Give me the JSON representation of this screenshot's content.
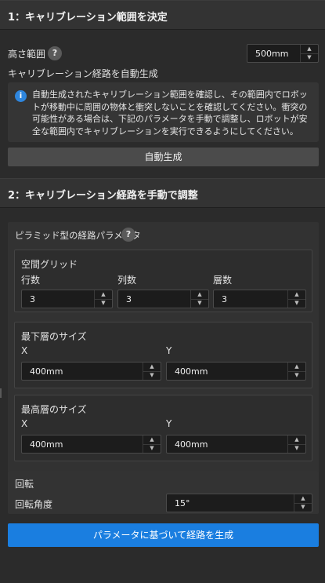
{
  "section1": {
    "title": "1：キャリブレーション範囲を決定",
    "height_label": "高さ範囲",
    "help_glyph": "?",
    "height_value": "500mm",
    "auto_path_label": "キャリブレーション経路を自動生成",
    "info_icon": "i",
    "info_text": "自動生成されたキャリブレーション範囲を確認し、その範囲内でロボットが移動中に周囲の物体と衝突しないことを確認してください。衝突の可能性がある場合は、下記のパラメータを手動で調整し、ロボットが安全な範囲内でキャリブレーションを実行できるようにしてください。",
    "auto_button": "自動生成"
  },
  "section2": {
    "title": "2：キャリブレーション経路を手動で調整",
    "pyramid_label": "ピラミッド型の経路パラメータ",
    "help_glyph": "?",
    "grid": {
      "title": "空間グリッド",
      "rows_label": "行数",
      "rows_value": "3",
      "cols_label": "列数",
      "cols_value": "3",
      "layers_label": "層数",
      "layers_value": "3"
    },
    "bottom": {
      "title": "最下層のサイズ",
      "x_label": "X",
      "x_value": "400mm",
      "y_label": "Y",
      "y_value": "400mm"
    },
    "top": {
      "title": "最高層のサイズ",
      "x_label": "X",
      "x_value": "400mm",
      "y_label": "Y",
      "y_value": "400mm"
    },
    "rotation": {
      "title": "回転",
      "angle_label": "回転角度",
      "angle_value": "15°"
    },
    "generate_button": "パラメータに基づいて経路を生成"
  },
  "icons": {
    "up": "▲",
    "down": "▼"
  },
  "colors": {
    "accent": "#1a7ee0",
    "info": "#2e86de",
    "background": "#2b2b2b"
  }
}
